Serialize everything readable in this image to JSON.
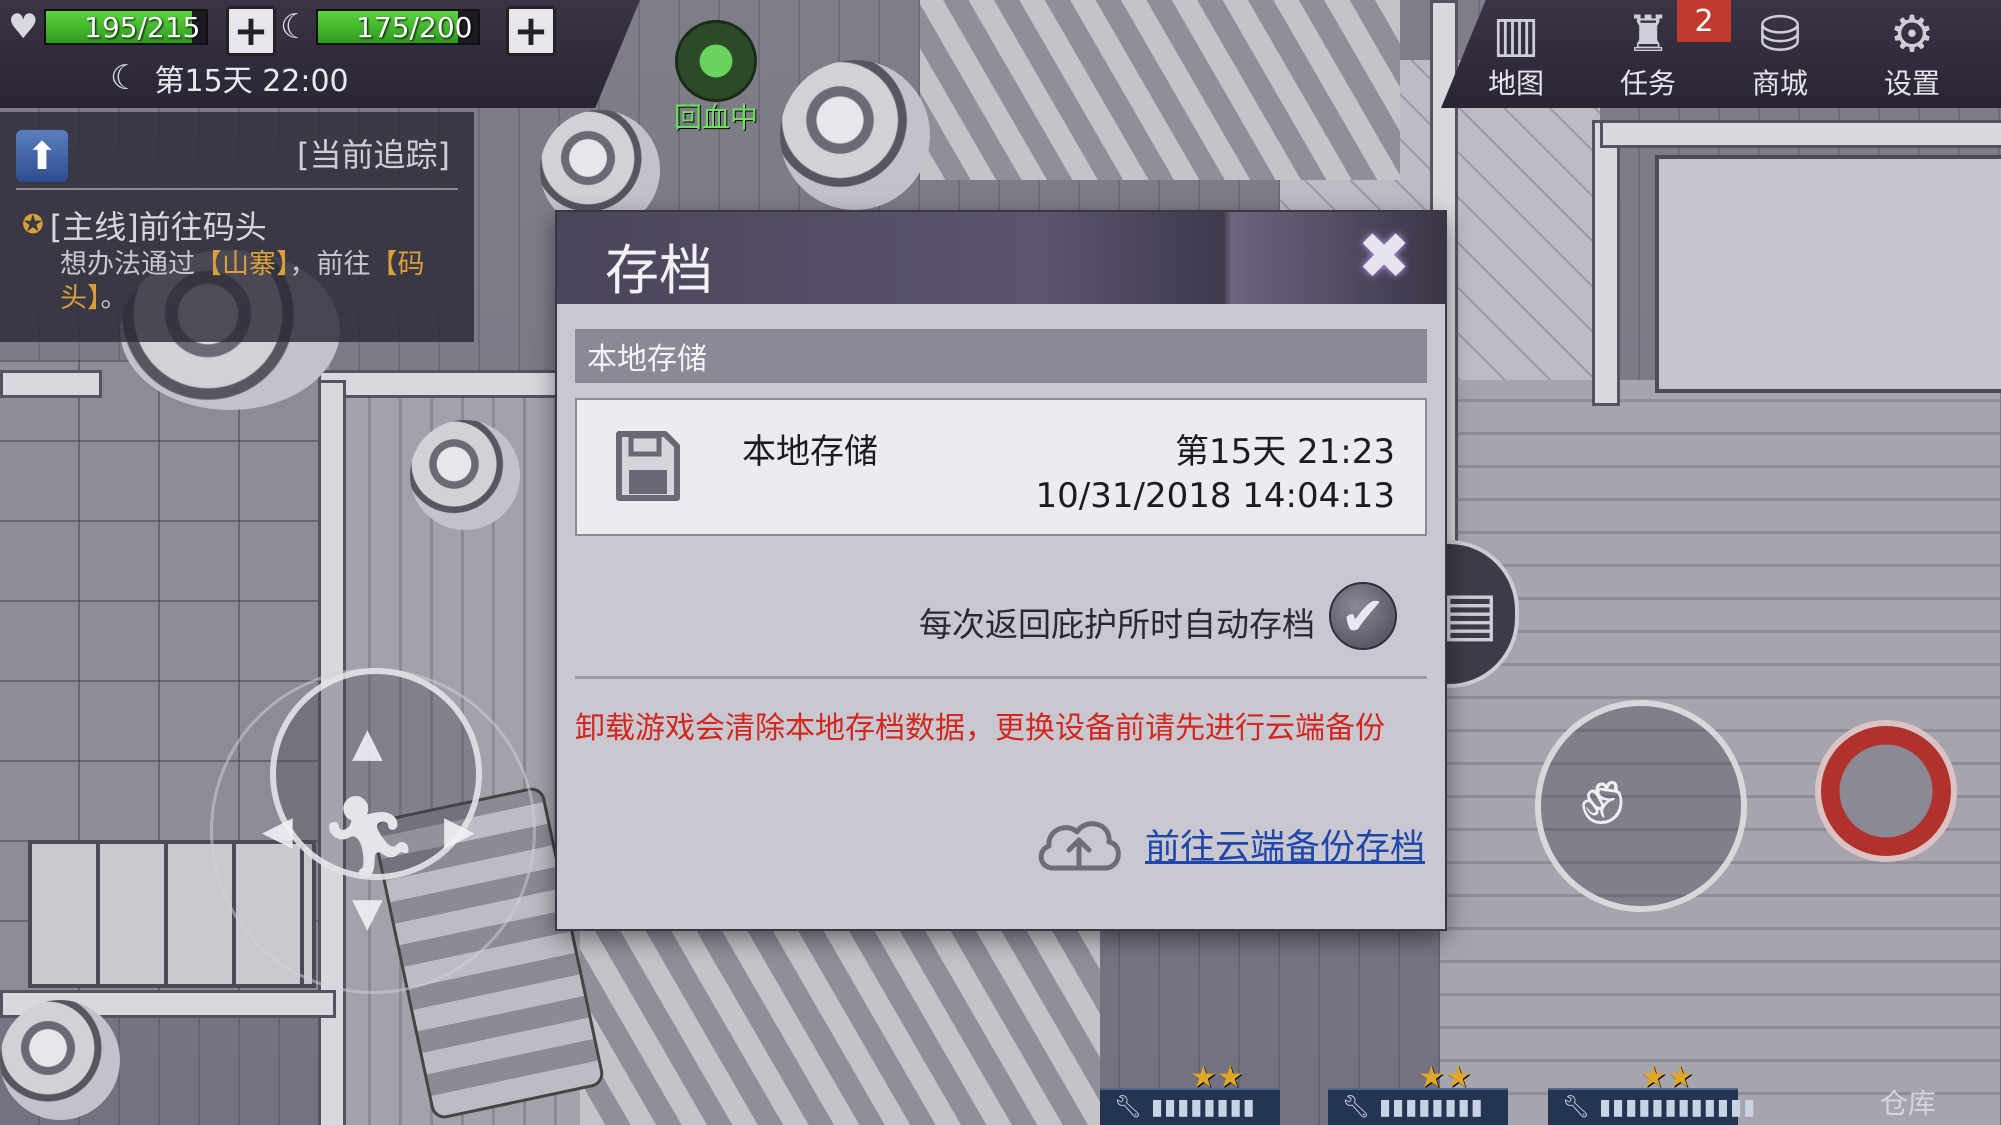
{
  "hud": {
    "health": {
      "value": 195,
      "max": 215,
      "text": "195/215"
    },
    "stamina": {
      "value": 175,
      "max": 200,
      "text": "175/200"
    },
    "day_time": "第15天 22:00",
    "status_label": "回血中"
  },
  "top_menu": {
    "map": "地图",
    "tasks": "任务",
    "tasks_badge": "2",
    "shop": "商城",
    "settings": "设置"
  },
  "quest": {
    "header": "[当前追踪]",
    "title": "[主线]前往码头",
    "desc_before": "想办法通过",
    "place1": "【山寨】",
    "desc_mid": "，前往",
    "place2": "【码头】",
    "desc_end": "。"
  },
  "modal": {
    "title": "存档",
    "section_label": "本地存储",
    "slot": {
      "name": "本地存储",
      "game_day": "第15天 21:23",
      "real_datetime": "10/31/2018 14:04:13"
    },
    "autosave_label": "每次返回庇护所时自动存档",
    "autosave_checked": true,
    "warning": "卸载游戏会清除本地存档数据，更换设备前请先进行云端备份",
    "cloud_link": "前往云端备份存档"
  },
  "bottom": {
    "warehouse": "仓库",
    "item_bars": [
      "▮▮▮▮▮▮▮▮",
      "▮▮▮▮▮▮▮▮",
      "▮▮▮▮▮▮▮▮▮▮▮▮"
    ]
  },
  "colors": {
    "health_bar": "#3fb52a",
    "warning_text": "#d2261e",
    "link_text": "#1f46a8",
    "quest_highlight": "#d9a03a"
  }
}
